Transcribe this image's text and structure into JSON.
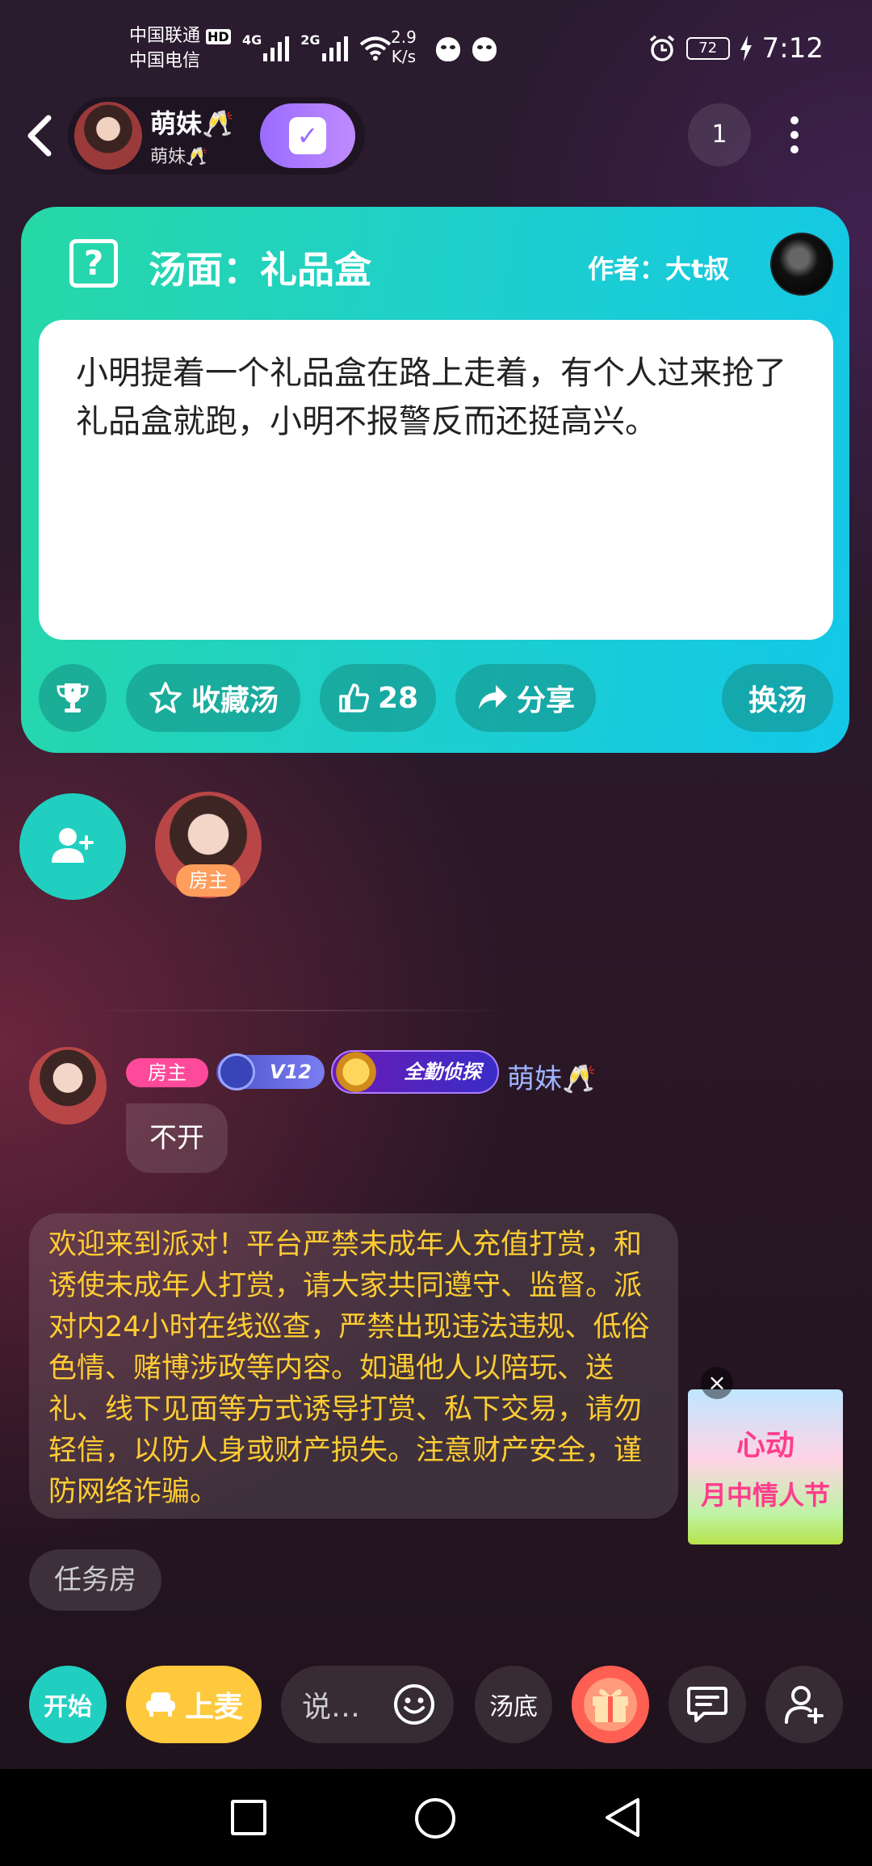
{
  "status_bar": {
    "carrier1": "中国联通",
    "carrier1_tag": "HD",
    "carrier2": "中国电信",
    "net1": "4G",
    "net2": "2G",
    "speed_value": "2.9",
    "speed_unit": "K/s",
    "battery": "72",
    "time": "7:12"
  },
  "header": {
    "host_name": "萌妹🥂",
    "host_sub": "萌妹🥂",
    "checkin_icon": "check-icon",
    "online_count": "1"
  },
  "puzzle": {
    "title": "汤面：礼品盒",
    "author": "作者：大t叔",
    "text": "小明提着一个礼品盒在路上走着，有个人过来抢了礼品盒就跑，小明不报警反而还挺高兴。",
    "favorite_label": "收藏汤",
    "like_count": "28",
    "share_label": "分享",
    "change_label": "换汤"
  },
  "seats": {
    "host_tag": "房主"
  },
  "chat": {
    "owner_badge": "房主",
    "level_badge": "V12",
    "detective_badge": "全勤侦探",
    "sender": "萌妹🥂",
    "message": "不开",
    "notice": "欢迎来到派对！平台严禁未成年人充值打赏，和诱使未成年人打赏，请大家共同遵守、监督。派对内24小时在线巡查，严禁出现违法违规、低俗色情、赌博涉政等内容。如遇他人以陪玩、送礼、线下见面等方式诱导打赏、私下交易，请勿轻信，以防人身或财产损失。注意财产安全，谨防网络诈骗。",
    "task_tag": "任务房"
  },
  "promo": {
    "line1": "心动",
    "line2": "月中情人节",
    "close": "×"
  },
  "bottom_bar": {
    "start": "开始",
    "mic": "上麦",
    "say_placeholder": "说…",
    "soup_bottom": "汤底"
  },
  "colors": {
    "teal": "#21cfc0",
    "yellow": "#ffc93d",
    "notice_text": "#ffcc33",
    "purple": "#9a6bff"
  }
}
